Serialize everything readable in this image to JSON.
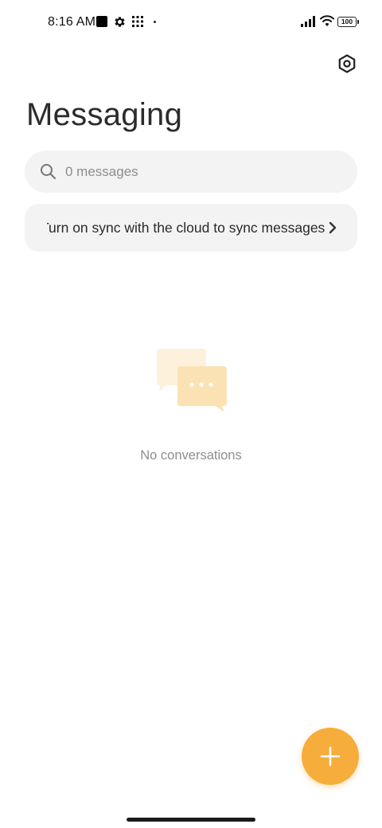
{
  "status_bar": {
    "time": "8:16 AM",
    "battery": "100",
    "icons": [
      "notification-square-icon",
      "gear-icon",
      "app-grid-icon",
      "dot-icon",
      "signal-icon",
      "wifi-icon",
      "battery-icon"
    ]
  },
  "header": {
    "title": "Messaging",
    "settings_icon": "settings-hexagon-icon"
  },
  "search": {
    "placeholder": "0 messages",
    "icon": "search-icon"
  },
  "sync_banner": {
    "text": "Turn on sync with the cloud to sync messages",
    "icon": "chevron-right-icon"
  },
  "empty_state": {
    "label": "No conversations",
    "icon": "chat-bubbles-icon"
  },
  "fab": {
    "icon": "plus-icon"
  },
  "colors": {
    "accent": "#f6ad3c",
    "surface": "#f3f3f3",
    "illustration_light": "#fdf1dc",
    "illustration_mid": "#fbe2b4"
  }
}
